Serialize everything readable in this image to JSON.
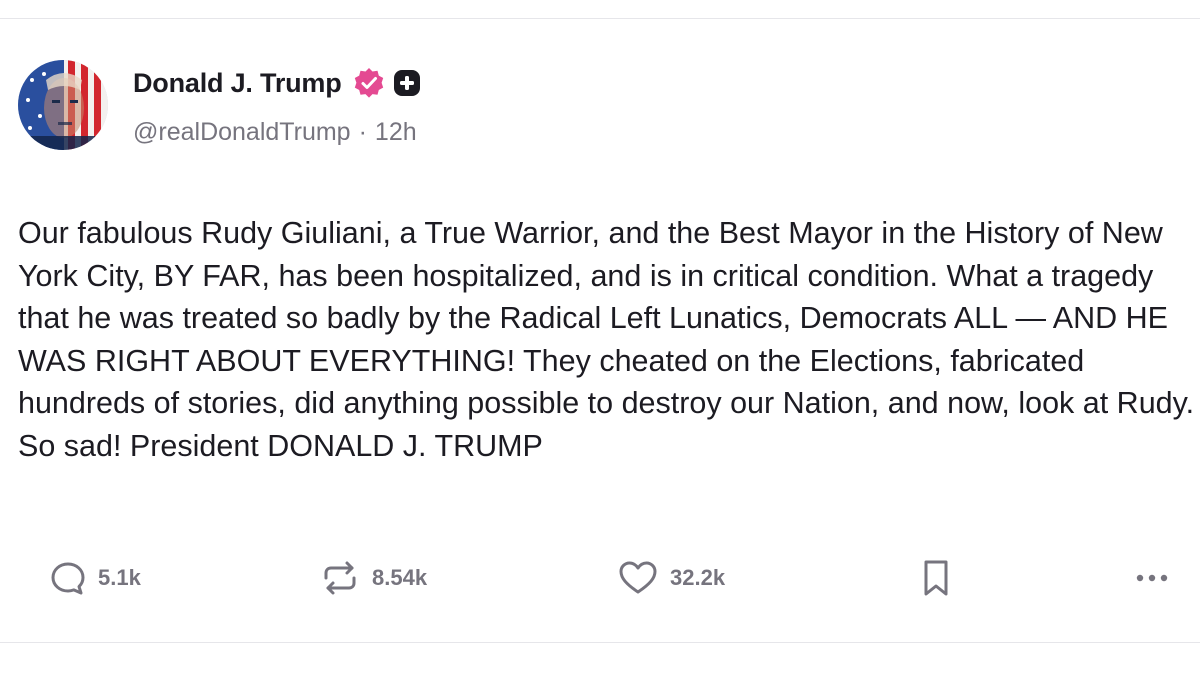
{
  "post": {
    "author": {
      "display_name": "Donald J. Trump",
      "handle": "@realDonaldTrump",
      "badge_color": "#e44a92",
      "avatar_icon": "avatar-image"
    },
    "separator": "·",
    "time_ago": "12h",
    "text": "Our fabulous Rudy Giuliani, a True Warrior, and the Best Mayor in the History of New York City, BY FAR, has been hospitalized, and is in critical condition. What a tragedy that he was treated so badly by the Radical Left Lunatics, Democrats ALL — AND HE WAS RIGHT ABOUT EVERYTHING! They cheated on the Elections, fabricated hundreds of stories, did anything possible to destroy our Nation, and now, look at Rudy. So sad! President DONALD J. TRUMP",
    "stats": {
      "replies": "5.1k",
      "reposts": "8.54k",
      "likes": "32.2k"
    },
    "icons": [
      "reply-icon",
      "repost-icon",
      "heart-icon",
      "bookmark-icon",
      "more-icon"
    ]
  }
}
